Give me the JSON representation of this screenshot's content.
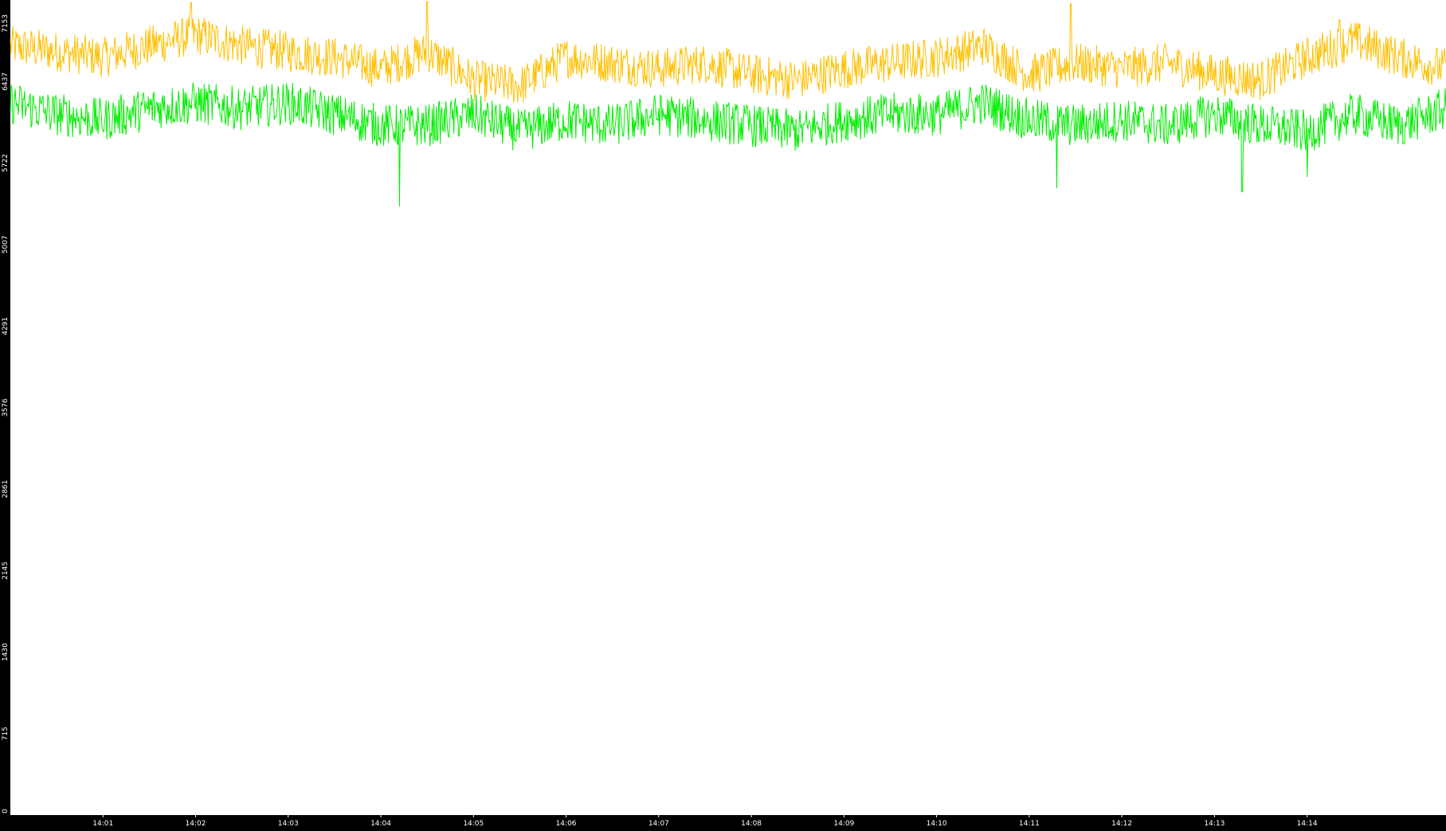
{
  "chart_data": {
    "type": "line",
    "title": "",
    "xlabel": "",
    "ylabel": "",
    "ylim": [
      0,
      7153
    ],
    "xlim_minutes": [
      0,
      15.5
    ],
    "y_ticks": [
      "0",
      "715",
      "1430",
      "2145",
      "2861",
      "3576",
      "4291",
      "5007",
      "5722",
      "6437",
      "7153"
    ],
    "y_tick_values": [
      0,
      715,
      1430,
      2145,
      2861,
      3576,
      4291,
      5007,
      5722,
      6437,
      7153
    ],
    "x_ticks": [
      "14:01",
      "14:02",
      "14:03",
      "14:04",
      "14:05",
      "14:06",
      "14:07",
      "14:08",
      "14:09",
      "14:10",
      "14:11",
      "14:12",
      "14:13",
      "14:14"
    ],
    "x_tick_values": [
      1,
      2,
      3,
      4,
      5,
      6,
      7,
      8,
      9,
      10,
      11,
      12,
      13,
      14
    ],
    "grid": false,
    "legend": "none",
    "background": "#ffffff",
    "frame_color": "#000000",
    "series": [
      {
        "color": "#ffc000",
        "x": [
          0,
          0.5,
          1,
          1.5,
          2,
          2.5,
          3,
          3.5,
          4,
          4.5,
          5,
          5.5,
          6,
          6.5,
          7,
          7.5,
          8,
          8.5,
          9,
          9.5,
          10,
          10.5,
          11,
          11.5,
          12,
          12.5,
          13,
          13.5,
          14,
          14.5,
          15,
          15.5
        ],
        "values": [
          6750,
          6700,
          6650,
          6750,
          6850,
          6750,
          6700,
          6650,
          6550,
          6700,
          6450,
          6400,
          6650,
          6600,
          6550,
          6600,
          6500,
          6450,
          6550,
          6600,
          6650,
          6750,
          6500,
          6600,
          6550,
          6600,
          6500,
          6450,
          6650,
          6800,
          6650,
          6550
        ],
        "spike_x": [
          1.95,
          4.5,
          11.45,
          14.35
        ],
        "spike_values": [
          7130,
          7140,
          7120,
          6980
        ]
      },
      {
        "color": "#00ee00",
        "x": [
          0,
          0.5,
          1,
          1.5,
          2,
          2.5,
          3,
          3.5,
          4,
          4.5,
          5,
          5.5,
          6,
          6.5,
          7,
          7.5,
          8,
          8.5,
          9,
          9.5,
          10,
          10.5,
          11,
          11.5,
          12,
          12.5,
          13,
          13.5,
          14,
          14.5,
          15,
          15.5
        ],
        "values": [
          6250,
          6150,
          6100,
          6200,
          6250,
          6200,
          6250,
          6150,
          6050,
          6050,
          6150,
          6000,
          6100,
          6050,
          6150,
          6100,
          6050,
          6000,
          6100,
          6150,
          6150,
          6250,
          6100,
          6050,
          6100,
          6050,
          6150,
          6050,
          6000,
          6150,
          6050,
          6200
        ],
        "dip_x": [
          4.2,
          11.3,
          13.3,
          14.0
        ],
        "dip_values": [
          5340,
          5500,
          5470,
          5600
        ]
      }
    ]
  }
}
